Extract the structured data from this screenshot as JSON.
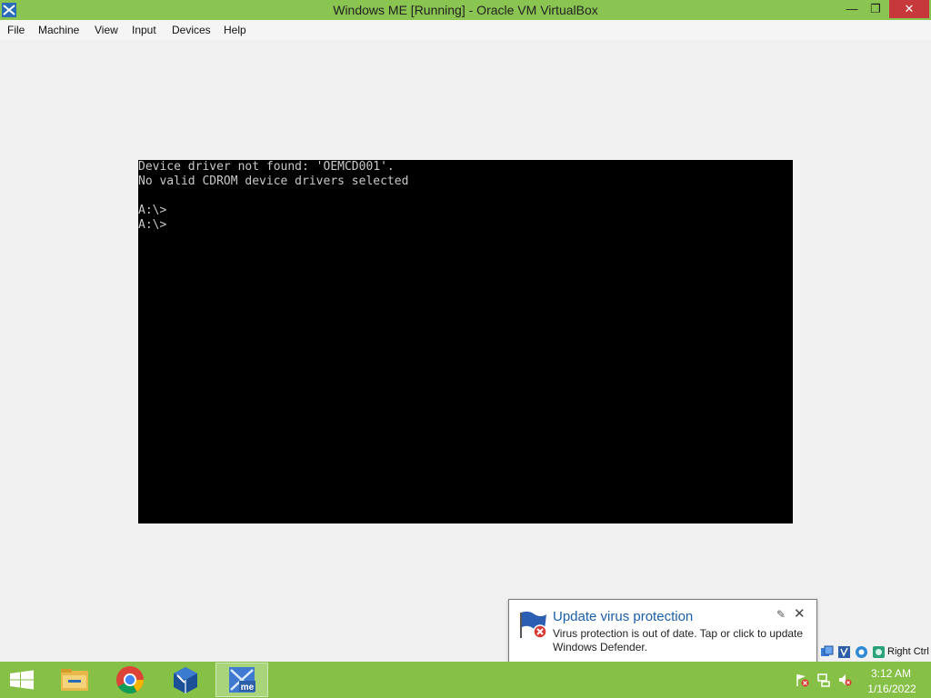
{
  "window": {
    "title": "Windows ME [Running] - Oracle VM VirtualBox",
    "controls": {
      "minimize": "—",
      "maximize": "❐",
      "close": "✕"
    }
  },
  "menubar": {
    "items": [
      "File",
      "Machine",
      "View",
      "Input",
      "Devices",
      "Help"
    ]
  },
  "console": {
    "lines": [
      "Device driver not found: 'OEMCD001'.",
      "No valid CDROM device drivers selected",
      "",
      "A:\\>",
      "A:\\>"
    ]
  },
  "vm_statusbar": {
    "icons": [
      "network-adapter-icon",
      "usb-icon",
      "shared-folders-icon",
      "optical-drive-icon",
      "keyboard-capture-icon"
    ],
    "host_key": "Right Ctrl"
  },
  "notification": {
    "title": "Update virus protection",
    "body": "Virus protection is out of date. Tap or click to update Windows Defender.",
    "icons": [
      "windows-defender-flag-icon",
      "error-icon",
      "pin-icon",
      "close-icon"
    ]
  },
  "taskbar": {
    "apps": [
      "file-explorer-icon",
      "chrome-icon",
      "virtualbox-icon",
      "windows-me-vm-icon"
    ],
    "active_app": "windows-me-vm-icon",
    "tray_icons": [
      "action-center-warning-icon",
      "network-icon",
      "volume-muted-icon"
    ],
    "time": "3:12 AM",
    "date": "1/16/2022",
    "accent_color": "#86c047"
  }
}
